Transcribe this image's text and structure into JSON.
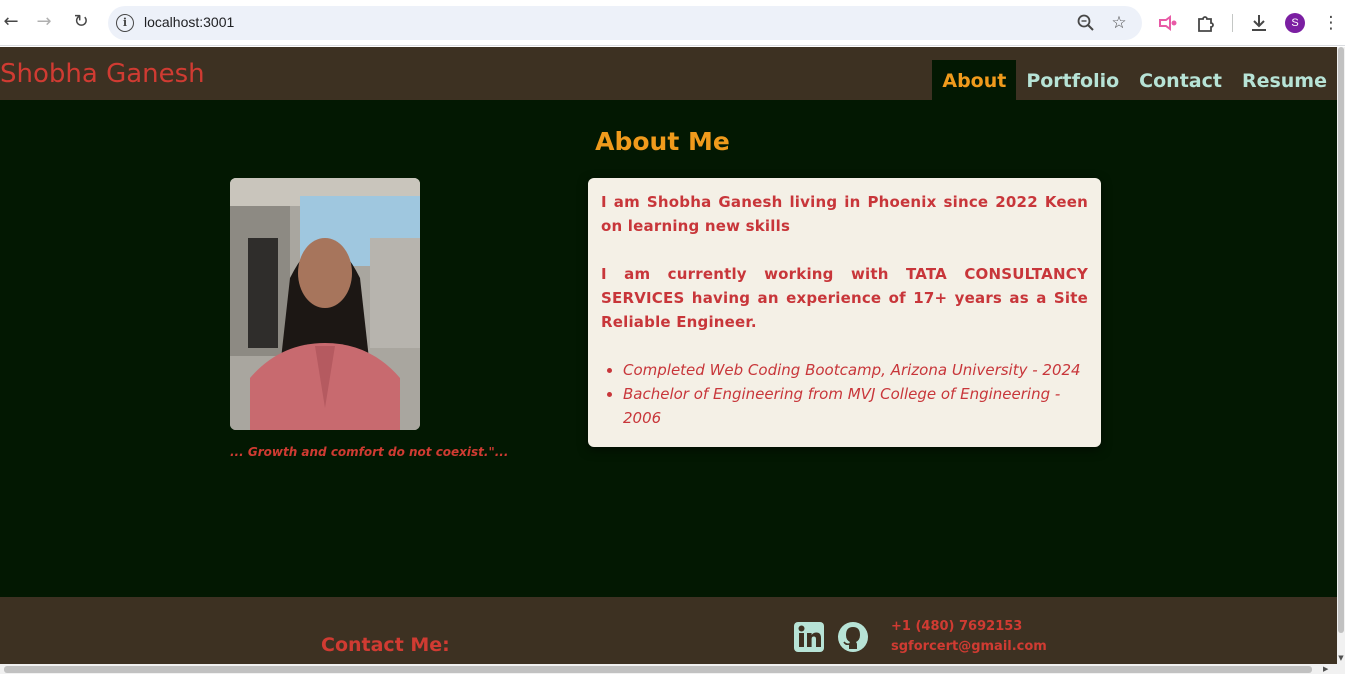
{
  "browser": {
    "url": "localhost:3001",
    "profile_initial": "S",
    "icons": [
      "back-icon",
      "forward-icon",
      "reload-icon",
      "site-info-icon",
      "zoom-icon",
      "bookmark-star-icon",
      "extension-pink-icon",
      "extensions-puzzle-icon",
      "download-icon",
      "profile-avatar",
      "menu-kebab-icon"
    ]
  },
  "header": {
    "brand": "Shobha Ganesh",
    "nav": [
      {
        "label": "About",
        "active": true
      },
      {
        "label": "Portfolio",
        "active": false
      },
      {
        "label": "Contact",
        "active": false
      },
      {
        "label": "Resume",
        "active": false
      }
    ]
  },
  "about": {
    "title": "About Me",
    "quote": "... Growth and comfort do not coexist.\"...",
    "paragraphs": [
      "I am Shobha Ganesh living in Phoenix since 2022 Keen on learning new skills",
      "I am currently working with TATA CONSULTANCY SERVICES having an experience of 17+ years as a Site Reliable Engineer."
    ],
    "education": [
      "Completed Web Coding Bootcamp, Arizona University - 2024",
      "Bachelor of Engineering from MVJ College of Engineering - 2006"
    ]
  },
  "footer": {
    "contact_label": "Contact Me:",
    "phone": "+1 (480) 7692153",
    "email": "sgforcert@gmail.com",
    "social": [
      "linkedin-icon",
      "github-icon"
    ]
  },
  "colors": {
    "page_bg": "#031802",
    "header_bg": "#3d3122",
    "accent": "#f09a1c",
    "brand_red": "#d03b32",
    "nav_text": "#b7e3d6",
    "card_bg": "#f4f0e6"
  }
}
